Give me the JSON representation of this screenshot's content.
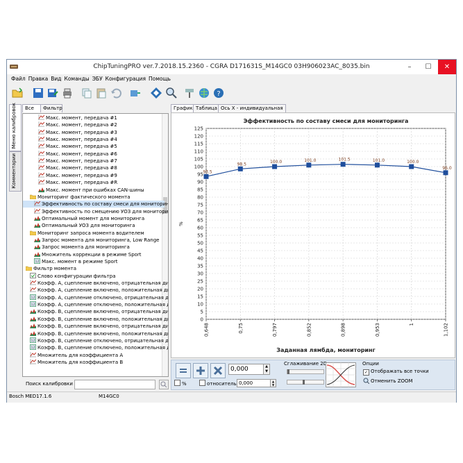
{
  "window": {
    "title": "ChipTuningPRO ver.7.2018.15.2360 - CGRA D171631S_M14GC0 03H906023AC_8035.bin",
    "minimize": "–",
    "maximize": "☐",
    "close": "✕"
  },
  "menu": [
    "Файл",
    "Правка",
    "Вид",
    "Команды",
    "ЭБУ",
    "Конфигурация",
    "Помощь"
  ],
  "toolbar_icons": [
    "open-folder-icon",
    "save-icon",
    "save-as-icon",
    "print-icon",
    "copy-icon",
    "paste-icon",
    "undo-icon",
    "connect-icon",
    "diagram-icon",
    "zoom-icon",
    "tools-icon",
    "globe-icon",
    "help-icon"
  ],
  "left": {
    "vtabs": [
      "Меню калибровок",
      "Комментарии"
    ],
    "tabs": [
      "Все",
      "Фильтр"
    ],
    "tree": [
      {
        "text": "Макс. момент, передача #1",
        "icon": "chart",
        "indent": 3
      },
      {
        "text": "Макс. момент, передача #2",
        "icon": "chart",
        "indent": 3
      },
      {
        "text": "Макс. момент, передача #3",
        "icon": "chart",
        "indent": 3
      },
      {
        "text": "Макс. момент, передача #4",
        "icon": "chart",
        "indent": 3
      },
      {
        "text": "Макс. момент, передача #5",
        "icon": "chart",
        "indent": 3
      },
      {
        "text": "Макс. момент, передача #6",
        "icon": "chart",
        "indent": 3
      },
      {
        "text": "Макс. момент, передача #7",
        "icon": "chart",
        "indent": 3
      },
      {
        "text": "Макс. момент, передача #8",
        "icon": "chart",
        "indent": 3
      },
      {
        "text": "Макс. момент, передача #9",
        "icon": "chart",
        "indent": 3
      },
      {
        "text": "Макс. момент, передача #R",
        "icon": "chart",
        "indent": 3
      },
      {
        "text": "Макс. момент при ошибках CAN-шины",
        "icon": "map",
        "indent": 3
      },
      {
        "text": "Мониторинг фактического момента",
        "icon": "folder",
        "indent": 1
      },
      {
        "text": "Эффективность по составу смеси для мониторинга",
        "icon": "chart",
        "indent": 2,
        "selected": true
      },
      {
        "text": "Эффективность по смещению УОЗ для мониторинга",
        "icon": "chart",
        "indent": 2
      },
      {
        "text": "Оптимальный момент для мониторинга",
        "icon": "map",
        "indent": 2
      },
      {
        "text": "Оптимальный УОЗ для мониторинга",
        "icon": "map",
        "indent": 2
      },
      {
        "text": "Мониторинг запроса момента водителем",
        "icon": "folder",
        "indent": 1
      },
      {
        "text": "Запрос момента для мониторинга, Low Range",
        "icon": "map",
        "indent": 2
      },
      {
        "text": "Запрос момента для мониторинга",
        "icon": "map",
        "indent": 2
      },
      {
        "text": "Множитель коррекции в режиме Sport",
        "icon": "map",
        "indent": 2
      },
      {
        "text": "Макс. момент в режиме Sport",
        "icon": "value",
        "indent": 2
      },
      {
        "text": "Фильтр момента",
        "icon": "folder",
        "indent": 0
      },
      {
        "text": "Слово конфигурации фильтра",
        "icon": "check",
        "indent": 1
      },
      {
        "text": "Коэфф. А, сцепление включено, отрицательная ди",
        "icon": "chart",
        "indent": 1
      },
      {
        "text": "Коэфф. А, сцепление включено, положительная ди",
        "icon": "chart",
        "indent": 1
      },
      {
        "text": "Коэфф. А, сцепление отключено, отрицательная д",
        "icon": "value",
        "indent": 1
      },
      {
        "text": "Коэфф. А, сцепление отключено, положительная д",
        "icon": "value",
        "indent": 1
      },
      {
        "text": "Коэфф. В, сцепление включено, отрицательная ди",
        "icon": "map",
        "indent": 1
      },
      {
        "text": "Коэфф. В, сцепление включено, положительная ди",
        "icon": "map",
        "indent": 1
      },
      {
        "text": "Коэфф. В, сцепление включено, отрицательная ди",
        "icon": "map",
        "indent": 1
      },
      {
        "text": "Коэфф. В, сцепление включено, положительная ди",
        "icon": "map",
        "indent": 1
      },
      {
        "text": "Коэфф. В, сцепление отключено, отрицательная д",
        "icon": "value",
        "indent": 1
      },
      {
        "text": "Коэфф. В, сцепление отключено, положительная д",
        "icon": "value",
        "indent": 1
      },
      {
        "text": "Множитель для коэффициента А",
        "icon": "chart",
        "indent": 1
      },
      {
        "text": "Множитель для коэффициента В",
        "icon": "chart",
        "indent": 1
      }
    ],
    "search_label": "Поиск калибровки",
    "search_value": ""
  },
  "right": {
    "tabs": [
      "График",
      "Таблица",
      "Ось X - индивидуальная"
    ],
    "controls": {
      "value": "0,000",
      "percent_label": "%",
      "relative_label": "относительно",
      "relative_value": "0,000",
      "smoothing_label": "Сглаживание 2D",
      "options_label": "Опции",
      "show_all_points": "Отображать все точки",
      "show_all_points_checked": true,
      "cancel_zoom": "Отменить ZOOM"
    }
  },
  "chart_data": {
    "type": "line",
    "title": "Эффективность по составу смеси для мониторинга",
    "xlabel": "Заданная лямбда, мониторинг",
    "ylabel": "%",
    "categories": [
      "0,648",
      "0,75",
      "0,797",
      "0,852",
      "0,898",
      "0,953",
      "1",
      "1,102"
    ],
    "x": [
      0.648,
      0.75,
      0.797,
      0.852,
      0.898,
      0.953,
      1,
      1.102
    ],
    "values": [
      93.5,
      98.5,
      100.0,
      101.0,
      101.5,
      101.0,
      100.0,
      96.0
    ],
    "labels": [
      "93.5",
      "98.5",
      "100.0",
      "101.0",
      "101.5",
      "101.0",
      "100.0",
      "96.0"
    ],
    "ylim": [
      0,
      125
    ],
    "yticks": [
      0,
      5,
      10,
      15,
      20,
      25,
      30,
      35,
      40,
      45,
      50,
      55,
      60,
      65,
      70,
      75,
      80,
      85,
      90,
      95,
      100,
      105,
      110,
      115,
      120,
      125
    ],
    "grid": true,
    "line_color": "#1f4e9c",
    "marker_color": "#1f4e9c"
  },
  "status": {
    "ecu": "Bosch MED17.1.6",
    "software": "M14GC0"
  }
}
